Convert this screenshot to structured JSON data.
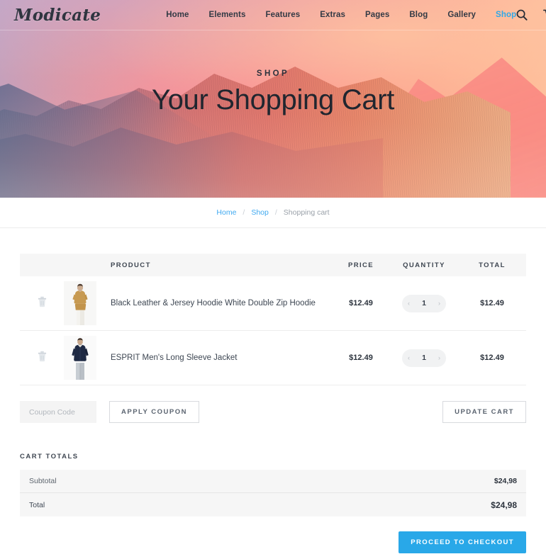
{
  "site": {
    "brand": "Modicate",
    "nav": [
      {
        "label": "Home",
        "active": false
      },
      {
        "label": "Elements",
        "active": false
      },
      {
        "label": "Features",
        "active": false
      },
      {
        "label": "Extras",
        "active": false
      },
      {
        "label": "Pages",
        "active": false
      },
      {
        "label": "Blog",
        "active": false
      },
      {
        "label": "Gallery",
        "active": false
      },
      {
        "label": "Shop",
        "active": true
      }
    ],
    "icons": {
      "search": "search-icon",
      "cart": "shopping-cart-icon"
    }
  },
  "hero": {
    "eyebrow": "SHOP",
    "title": "Your Shopping Cart"
  },
  "breadcrumb": {
    "home": "Home",
    "shop": "Shop",
    "current": "Shopping cart",
    "separator": "/"
  },
  "cart": {
    "headers": {
      "product": "PRODUCT",
      "price": "PRICE",
      "quantity": "QUANTITY",
      "total": "TOTAL"
    },
    "items": [
      {
        "name": "Black Leather & Jersey Hoodie White Double Zip Hoodie",
        "price": "$12.49",
        "quantity": "1",
        "total": "$12.49",
        "thumb_alt": "woman in mustard top and white trousers",
        "remove_icon": "trash-icon"
      },
      {
        "name": "ESPRIT Men's Long Sleeve Jacket",
        "price": "$12.49",
        "quantity": "1",
        "total": "$12.49",
        "thumb_alt": "man in navy jacket and grey jeans",
        "remove_icon": "trash-icon"
      }
    ],
    "stepper": {
      "decrement": "‹",
      "increment": "›"
    }
  },
  "coupon": {
    "placeholder": "Coupon Code",
    "value": "",
    "apply_label": "APPLY COUPON",
    "update_label": "UPDATE CART"
  },
  "totals": {
    "title": "CART TOTALS",
    "rows": [
      {
        "label": "Subtotal",
        "value": "$24,98"
      },
      {
        "label": "Total",
        "value": "$24,98"
      }
    ]
  },
  "checkout": {
    "label": "PROCEED TO CHECKOUT"
  },
  "colors": {
    "accent_blue": "#29a8e8",
    "link_blue": "#3fa9f0",
    "table_header_bg": "#f6f6f6",
    "text_dark": "#2c333d",
    "muted": "#9aa1a9"
  }
}
